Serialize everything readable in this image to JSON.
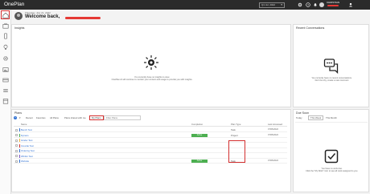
{
  "app": {
    "title": "OnePlan",
    "date_range": "Q1 Jul, 2022",
    "user_name": "CHRISTIAN"
  },
  "welcome": {
    "date": "Thursday, July 21, 2022",
    "greeting": "Welcome back,"
  },
  "insights": {
    "title": "Insights",
    "empty_line1": "You currently have no insights to view.",
    "empty_line2": "OnePlan AI will continue to monitor your content and usage to provide you with insights."
  },
  "recent": {
    "title": "Recent Conversations",
    "empty_line1": "You currently have no recent conversations.",
    "empty_line2": "Don't be shy, create a new comment"
  },
  "plans": {
    "title": "Plans",
    "toolbar": {
      "add": "+",
      "recent": "Recent",
      "favorites": "Favorites",
      "all_plans": "All Plans",
      "shared": "Plans shared with me",
      "my_plans": "My Plans",
      "filter_placeholder": "Filter Plans"
    },
    "columns": {
      "name": "Name",
      "completion": "Completion",
      "plan_type": "Plan Type",
      "last_accessed": "Last Accessed"
    },
    "rows": [
      {
        "name": "Bench Test",
        "badge": "",
        "type": "Task",
        "date": "07/05/2022",
        "bar": "#2d6fd2"
      },
      {
        "name": "Dynaco",
        "badge": "Active",
        "type": "Project",
        "date": "07/05/2022",
        "bar": "#4caf50"
      },
      {
        "name": "Griefer Test",
        "badge": "",
        "type": "",
        "date": "",
        "bar": "#f2b233"
      },
      {
        "name": "Inrevide Test",
        "badge": "",
        "type": "",
        "date": "",
        "bar": "#d32f2f"
      },
      {
        "name": "Ordering Test",
        "badge": "",
        "type": "",
        "date": "",
        "bar": "#2d6fd2"
      },
      {
        "name": "Whitfer Test",
        "badge": "",
        "type": "",
        "date": "",
        "bar": "#7e57c2"
      },
      {
        "name": "Website",
        "badge": "Active",
        "type": "Task",
        "date": "07/05/2022",
        "bar": "#2d6fd2"
      }
    ]
  },
  "due": {
    "title": "Due Soon",
    "toolbar": {
      "today": "Today",
      "this_week": "This Week",
      "this_month": "This Month"
    },
    "empty_line1": "You have no work due.",
    "empty_line2": "Click the \"My Work\" icon to see all work assigned to you."
  },
  "colors": {
    "accent": "#2d6fd2",
    "active_badge": "#4caf50",
    "highlight": "#d32f2f",
    "topbar": "#2b2b2b"
  }
}
